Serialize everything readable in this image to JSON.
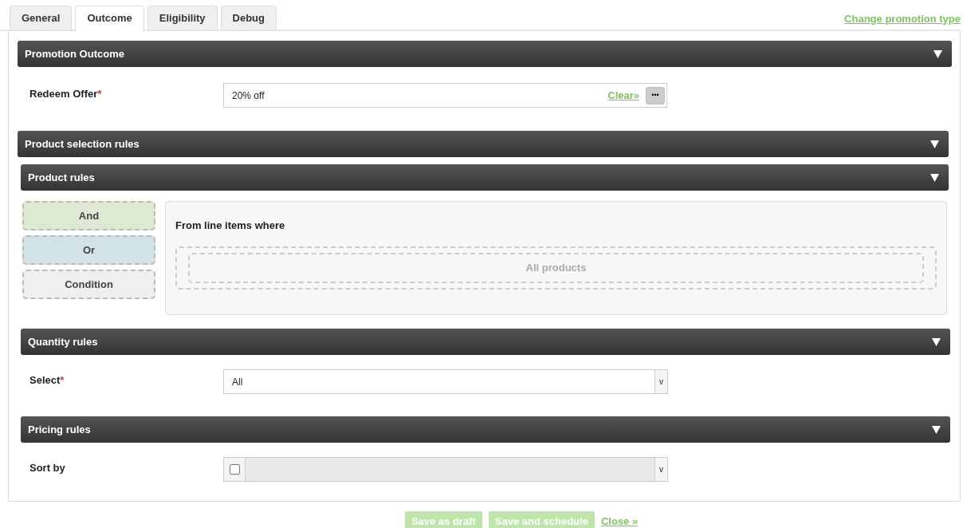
{
  "tabs": [
    {
      "label": "General",
      "selected": false
    },
    {
      "label": "Outcome",
      "selected": true
    },
    {
      "label": "Eligibility",
      "selected": false
    },
    {
      "label": "Debug",
      "selected": false
    }
  ],
  "change_link": "Change promotion type",
  "promotion_outcome": {
    "title": "Promotion Outcome",
    "expanded": true,
    "redeem_offer": {
      "label": "Redeem Offer",
      "required_mark": "*",
      "value": "20% off",
      "clear": "Clear»",
      "browse": "•••"
    }
  },
  "product_selection": {
    "title": "Product selection rules",
    "expanded": true
  },
  "product_rules": {
    "title": "Product rules",
    "expanded": true,
    "tools": [
      {
        "label": "And",
        "kind": "and"
      },
      {
        "label": "Or",
        "kind": "or"
      },
      {
        "label": "Condition",
        "kind": "condition"
      }
    ],
    "heading": "From line items where",
    "drop_zone": "All products"
  },
  "quantity_rules": {
    "title": "Quantity rules",
    "expanded": true,
    "select": {
      "label": "Select",
      "required_mark": "*",
      "value": "All",
      "caret": "v"
    }
  },
  "pricing_rules": {
    "title": "Pricing rules",
    "expanded": true,
    "sort_by": {
      "label": "Sort by",
      "checked": false,
      "caret": "v"
    }
  },
  "footer": {
    "buttons": [
      {
        "label": "Save as draft",
        "disabled": true
      },
      {
        "label": "Save and schedule",
        "disabled": true
      }
    ],
    "close": "Close »"
  }
}
